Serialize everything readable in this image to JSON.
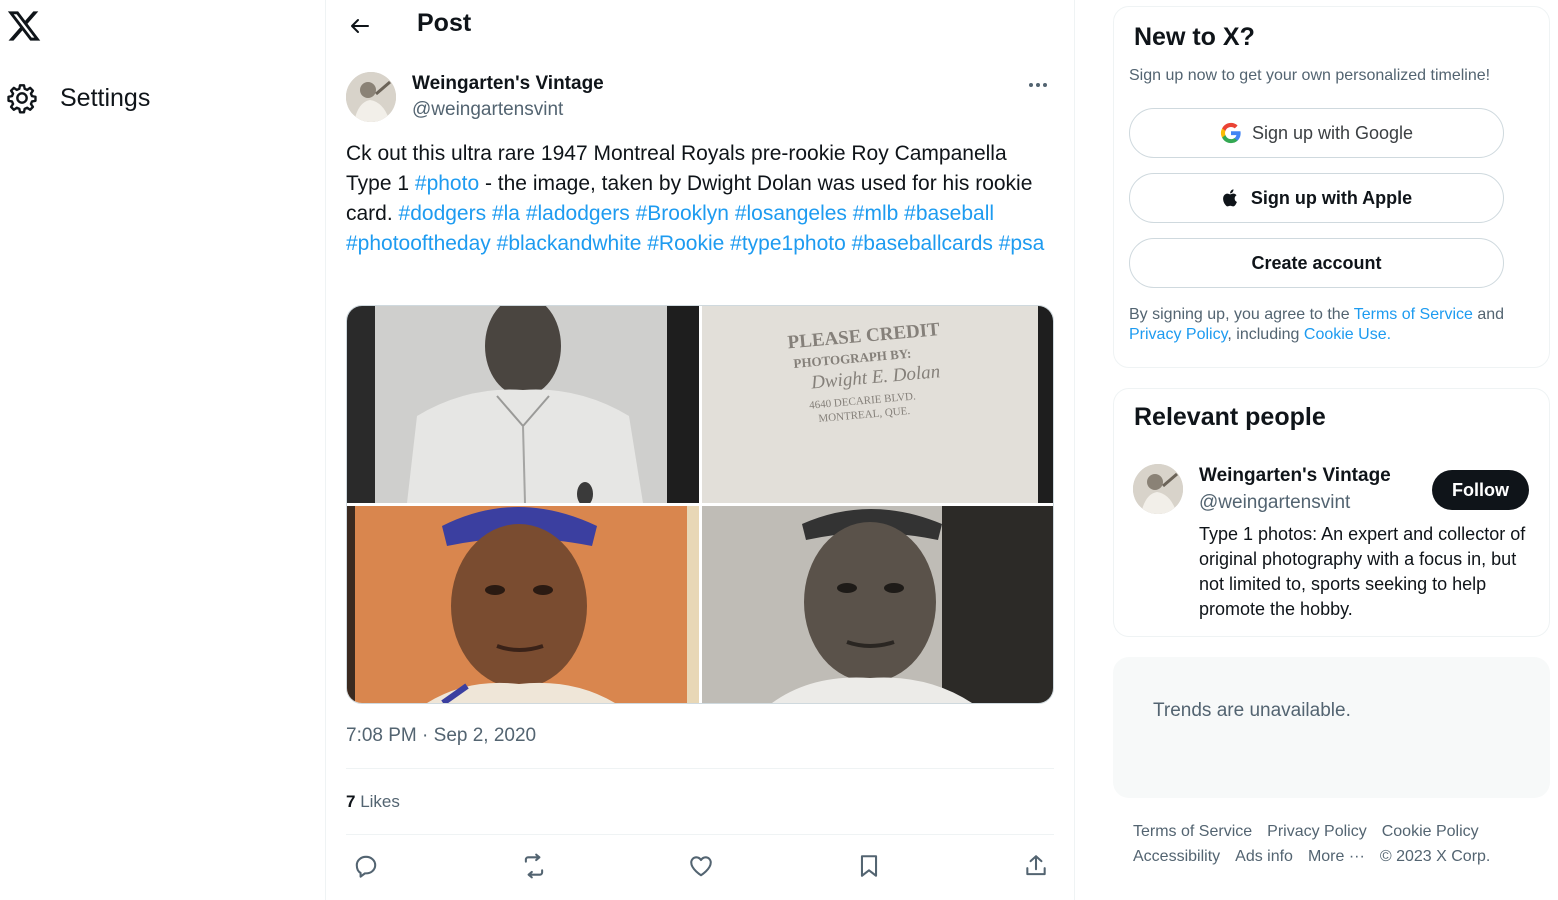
{
  "nav": {
    "logo_icon": "x-logo-icon",
    "settings_label": "Settings",
    "settings_icon": "gear-icon"
  },
  "header": {
    "back_icon": "arrow-left-icon",
    "title": "Post"
  },
  "post": {
    "author_name": "Weingarten's Vintage",
    "author_handle": "@weingartensvint",
    "text_parts": [
      {
        "t": "Ck out this ultra rare 1947 Montreal Royals pre-rookie Roy Campanella Type 1 ",
        "link": false
      },
      {
        "t": "#photo",
        "link": true
      },
      {
        "t": " - the image, taken by Dwight Dolan was used for his rookie card. ",
        "link": false
      },
      {
        "t": "#dodgers",
        "link": true
      },
      {
        "t": " ",
        "link": false
      },
      {
        "t": "#la",
        "link": true
      },
      {
        "t": " ",
        "link": false
      },
      {
        "t": "#ladodgers",
        "link": true
      },
      {
        "t": " ",
        "link": false
      },
      {
        "t": "#Brooklyn",
        "link": true
      },
      {
        "t": " ",
        "link": false
      },
      {
        "t": "#losangeles",
        "link": true
      },
      {
        "t": " ",
        "link": false
      },
      {
        "t": "#mlb",
        "link": true
      },
      {
        "t": " ",
        "link": false
      },
      {
        "t": "#baseball",
        "link": true
      },
      {
        "t": " ",
        "link": false
      },
      {
        "t": "#photooftheday",
        "link": true
      },
      {
        "t": " ",
        "link": false
      },
      {
        "t": "#blackandwhite",
        "link": true
      },
      {
        "t": " ",
        "link": false
      },
      {
        "t": "#Rookie",
        "link": true
      },
      {
        "t": " ",
        "link": false
      },
      {
        "t": "#type1photo",
        "link": true
      },
      {
        "t": " ",
        "link": false
      },
      {
        "t": "#baseballcards",
        "link": true
      },
      {
        "t": " ",
        "link": false
      },
      {
        "t": "#psa",
        "link": true
      }
    ],
    "stamp": {
      "line1": "PLEASE CREDIT",
      "line2": "PHOTOGRAPH BY:",
      "line3": "Dwight E. Dolan",
      "line4": "4640 DECARIE BLVD.",
      "line5": "MONTREAL, QUE."
    },
    "timestamp": "7:08 PM · Sep 2, 2020",
    "likes_count": "7",
    "likes_label": " Likes"
  },
  "sidebar": {
    "new_to_x": {
      "title": "New to X?",
      "subtitle": "Sign up now to get your own personalized timeline!",
      "google_label": "Sign up with Google",
      "apple_label": "Sign up with Apple",
      "create_label": "Create account",
      "terms_pre": "By signing up, you agree to the ",
      "terms_link": "Terms of Service",
      "terms_mid": " and ",
      "privacy_link": "Privacy Policy",
      "terms_mid2": ", including ",
      "cookie_link": "Cookie Use."
    },
    "relevant_people": {
      "title": "Relevant people",
      "name": "Weingarten's Vintage",
      "handle": "@weingartensvint",
      "follow_label": "Follow",
      "bio": "Type 1 photos: An expert and collector of original photography with a focus in, but not limited to, sports seeking to help promote the hobby."
    },
    "trends": {
      "text": "Trends are unavailable."
    },
    "footer": {
      "row1": [
        "Terms of Service",
        "Privacy Policy",
        "Cookie Policy"
      ],
      "row2": [
        "Accessibility",
        "Ads info",
        "More ···",
        "© 2023 X Corp."
      ]
    }
  },
  "colors": {
    "link": "#1d9bf0",
    "text": "#0f1419",
    "muted": "#536471"
  }
}
